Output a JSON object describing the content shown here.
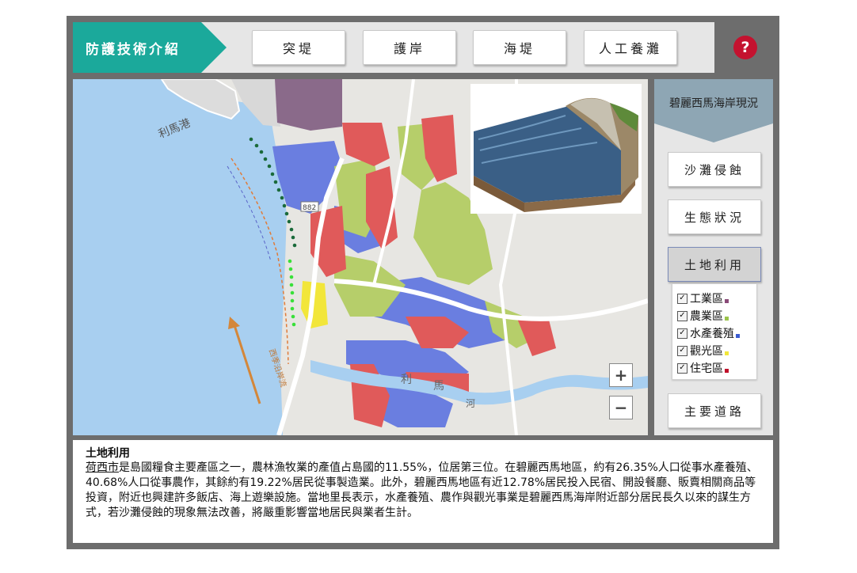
{
  "header": {
    "brand": "防護技術介紹",
    "tabs": [
      "突堤",
      "護岸",
      "海堤",
      "人工養灘"
    ],
    "help": "?"
  },
  "map": {
    "labels": {
      "port": "利馬港",
      "road": "882",
      "river1": "利",
      "river2": "馬",
      "river3": "河",
      "current": "西季沿岸流"
    },
    "zoom_in": "+",
    "zoom_out": "−"
  },
  "sidebar": {
    "title": "碧麗西馬海岸現況",
    "buttons": [
      "沙灘侵蝕",
      "生態狀況",
      "土地利用",
      "主要道路"
    ],
    "active": "土地利用",
    "legend": [
      {
        "label": "工業區",
        "checked": "✓",
        "color": "#8a4a78"
      },
      {
        "label": "農業區",
        "checked": "✓",
        "color": "#9bc34a"
      },
      {
        "label": "水產養殖",
        "checked": "✓",
        "color": "#3b5bd0"
      },
      {
        "label": "觀光區",
        "checked": "✓",
        "color": "#f2e63a"
      },
      {
        "label": "住宅區",
        "checked": "✓",
        "color": "#c0102a"
      }
    ]
  },
  "info": {
    "title": "土地利用",
    "link": "荷西市",
    "text": "是島國糧食主要產區之一，農林漁牧業的產值占島國的11.55%，位居第三位。在碧麗西馬地區，約有26.35%人口從事水產養殖、40.68%人口從事農作，其餘約有19.22%居民從事製造業。此外，碧麗西馬地區有近12.78%居民投入民宿、開設餐廳、販賣相關商品等投資，附近也興建許多飯店、海上遊樂設施。當地里長表示，水產養殖、農作與觀光事業是碧麗西馬海岸附近部分居民長久以來的謀生方式，若沙灘侵蝕的現象無法改善，將嚴重影響當地居民與業者生計。"
  }
}
